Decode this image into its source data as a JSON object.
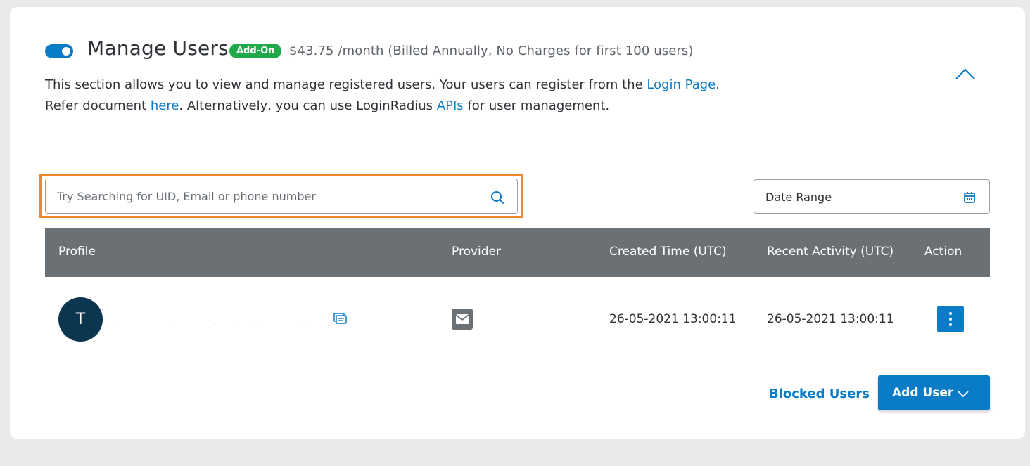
{
  "header": {
    "title": "Manage Users",
    "badge": "Add-On",
    "price": "$43.75 /month (Billed Annually, No Charges for first 100 users)",
    "description": {
      "part1": "This section allows you to view and manage registered users. Your users can register from the ",
      "link_login": "Login Page",
      "part2": ". Refer document ",
      "link_here": "here",
      "part3": ". Alternatively, you can use LoginRadius ",
      "link_apis": "APIs",
      "part4": " for user management."
    },
    "toggle_on": true
  },
  "search": {
    "placeholder": "Try Searching for UID, Email or phone number",
    "value": ""
  },
  "date_range": {
    "label": "Date Range"
  },
  "table": {
    "columns": {
      "profile": "Profile",
      "provider": "Provider",
      "created": "Created Time (UTC)",
      "recent": "Recent Activity (UTC)",
      "action": "Action"
    },
    "rows": [
      {
        "avatar_initial": "T",
        "provider_icon": "email-icon",
        "created": "26-05-2021 13:00:11",
        "recent": "26-05-2021 13:00:11"
      }
    ]
  },
  "footer": {
    "blocked_users": "Blocked Users",
    "add_user": "Add User"
  },
  "colors": {
    "accent": "#0a7bc6",
    "badge": "#21a84a",
    "highlight": "#f5862a",
    "table_header": "#6b7075",
    "avatar": "#0c3550"
  }
}
